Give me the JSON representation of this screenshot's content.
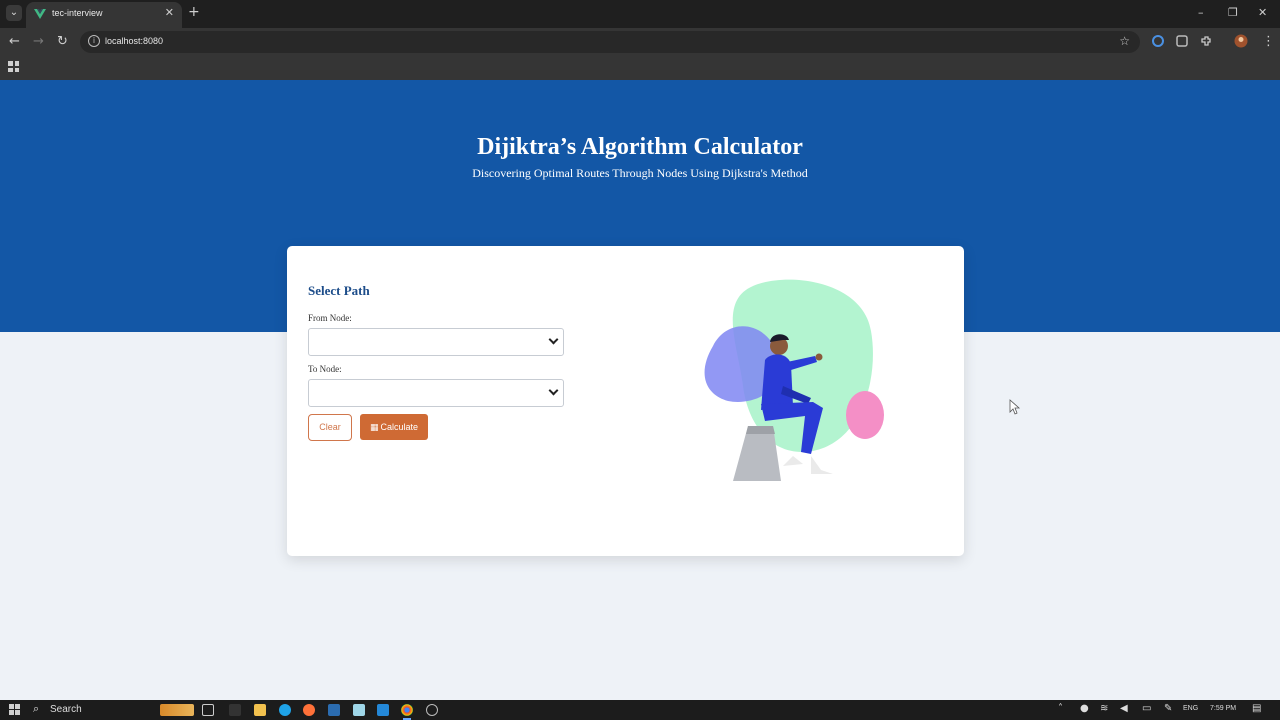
{
  "browser": {
    "tab_title": "tec-interview",
    "tab_close": "✕",
    "new_tab": "+",
    "url": "localhost:8080",
    "icons": [
      "tab-list-icon",
      "vue-favicon",
      "back-icon",
      "forward-icon",
      "reload-icon",
      "site-info-icon",
      "bookmark-star-icon",
      "extension-icon",
      "profile-avatar",
      "menu-icon",
      "apps-icon"
    ],
    "window_controls": [
      "–",
      "❐",
      "✕"
    ]
  },
  "page": {
    "title": "Dijiktra’s Algorithm Calculator",
    "subtitle": "Discovering Optimal Routes Through Nodes Using Dijkstra's Method",
    "card": {
      "heading": "Select Path",
      "from_label": "From Node:",
      "from_value": "",
      "to_label": "To Node:",
      "to_value": "",
      "clear_label": "Clear",
      "calculate_label": "Calculate",
      "calculate_icon": "calculator-icon"
    },
    "colors": {
      "hero": "#1357a6",
      "accent": "#cf6a34",
      "heading": "#1d4d8a"
    }
  },
  "taskbar": {
    "search_label": "Search",
    "language": "ENG",
    "time": "7:59 PM"
  }
}
